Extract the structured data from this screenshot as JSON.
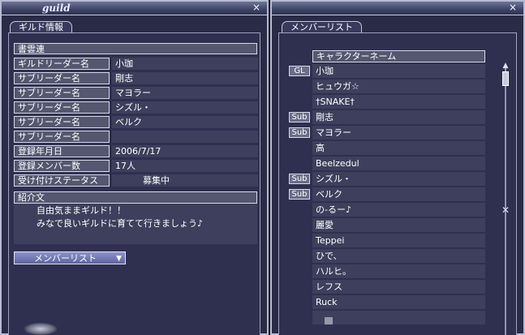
{
  "guild_window": {
    "title": "guild",
    "close_glyph": "×",
    "tab": "ギルド情報",
    "header": "書雲連",
    "fields": [
      {
        "label": "ギルドリーダー名",
        "value": "小珈"
      },
      {
        "label": "サブリーダー名",
        "value": "剛志"
      },
      {
        "label": "サブリーダー名",
        "value": "マヨラー"
      },
      {
        "label": "サブリーダー名",
        "value": "シズル・"
      },
      {
        "label": "サブリーダー名",
        "value": "ベルク"
      },
      {
        "label": "サブリーダー名",
        "value": ""
      },
      {
        "label": "登録年月日",
        "value": "2006/7/17"
      },
      {
        "label": "登録メンバー数",
        "value": "17人"
      },
      {
        "label": "受け付けステータス",
        "value": "募集中"
      }
    ],
    "intro_label": "紹介文",
    "intro_lines": [
      "自由気ままギルド！！",
      "みなで良いギルドに育てて行きましょう♪"
    ],
    "member_list_button": "メンバーリスト",
    "dropdown_glyph": "▼"
  },
  "member_window": {
    "close_glyph": "×",
    "tab": "メンバーリスト",
    "column_header": "キャラクターネーム",
    "members": [
      {
        "rank": "GL",
        "name": "小珈"
      },
      {
        "rank": "",
        "name": "ヒュウガ☆"
      },
      {
        "rank": "",
        "name": "†SNAKE†"
      },
      {
        "rank": "Sub",
        "name": "剛志"
      },
      {
        "rank": "Sub",
        "name": "マヨラー"
      },
      {
        "rank": "",
        "name": "高"
      },
      {
        "rank": "",
        "name": "Beelzedul"
      },
      {
        "rank": "Sub",
        "name": "シズル・"
      },
      {
        "rank": "Sub",
        "name": "ベルク"
      },
      {
        "rank": "",
        "name": "の-るー♪"
      },
      {
        "rank": "",
        "name": "麗愛"
      },
      {
        "rank": "",
        "name": "Teppei"
      },
      {
        "rank": "",
        "name": "ひで、"
      },
      {
        "rank": "",
        "name": "ハルヒ。"
      },
      {
        "rank": "",
        "name": "レフス"
      },
      {
        "rank": "",
        "name": "Ruck"
      },
      {
        "rank": "",
        "name": ""
      }
    ],
    "scroll_up_glyph": "▲",
    "scroll_grip_glyph": "✕"
  }
}
